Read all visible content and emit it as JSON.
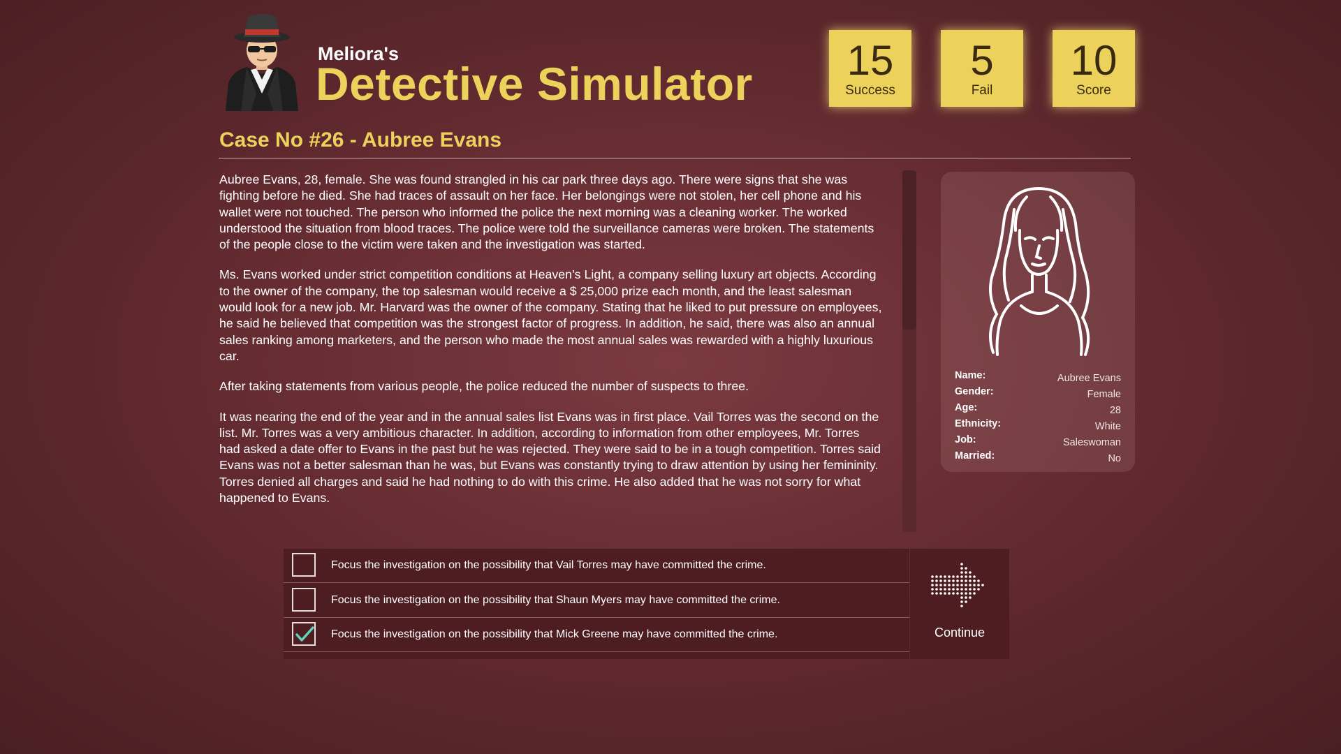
{
  "brand": {
    "subtitle": "Meliora's",
    "title": "Detective Simulator"
  },
  "stats": [
    {
      "value": "15",
      "label": "Success"
    },
    {
      "value": "5",
      "label": "Fail"
    },
    {
      "value": "10",
      "label": "Score"
    }
  ],
  "case": {
    "title": "Case No #26 - Aubree Evans",
    "paragraphs": [
      "Aubree Evans, 28, female. She was found strangled in his car park three days ago. There were signs that she was fighting before he died. She had traces of assault on her face. Her belongings were not stolen, her cell phone and his wallet were not touched. The person who informed the police the next morning was a cleaning worker. The worked understood the situation from blood traces. The police were told the surveillance cameras were broken. The statements of the people close to the victim were taken and the investigation was started.",
      "Ms. Evans worked under strict competition conditions at Heaven’s Light, a company selling luxury art objects. According to the owner of the company, the top salesman would receive a $ 25,000 prize each month, and the least salesman would look for a new job. Mr. Harvard was the owner of the company. Stating that he liked to put pressure on employees, he said he believed that competition was the strongest factor of progress. In addition, he said, there was also an annual sales ranking among marketers, and the person who made the most annual sales was rewarded with a highly luxurious car.",
      "After taking statements from various people, the police reduced the number of suspects to three.",
      "It was nearing the end of the year and in the annual sales list Evans was in first place. Vail Torres was the second on the list. Mr. Torres was a very ambitious character. In addition, according to information from other employees, Mr. Torres had asked a date offer to Evans in the past but he was rejected. They were said to be in a tough competition. Torres said Evans was not a better salesman than he was, but Evans was constantly trying to draw attention by using her femininity. Torres denied all charges and said he had nothing to do with this crime. He also added that he was not sorry for what happened to Evans."
    ]
  },
  "profile": {
    "fields": [
      {
        "label": "Name:",
        "value": "Aubree Evans"
      },
      {
        "label": "Gender:",
        "value": "Female"
      },
      {
        "label": "Age:",
        "value": "28"
      },
      {
        "label": "Ethnicity:",
        "value": "White"
      },
      {
        "label": "Job:",
        "value": "Saleswoman"
      },
      {
        "label": "Married:",
        "value": "No"
      }
    ]
  },
  "options": [
    {
      "text": "Focus the investigation on the possibility that Vail Torres may have committed the crime.",
      "checked": false
    },
    {
      "text": "Focus the investigation on the possibility that Shaun Myers may have committed the crime.",
      "checked": false
    },
    {
      "text": "Focus the investigation on the possibility that Mick Greene may have committed the crime.",
      "checked": true
    }
  ],
  "continue_label": "Continue",
  "colors": {
    "accent_yellow": "#ecd25a",
    "background": "#6a2f35",
    "check_teal": "#5fd4b8"
  }
}
